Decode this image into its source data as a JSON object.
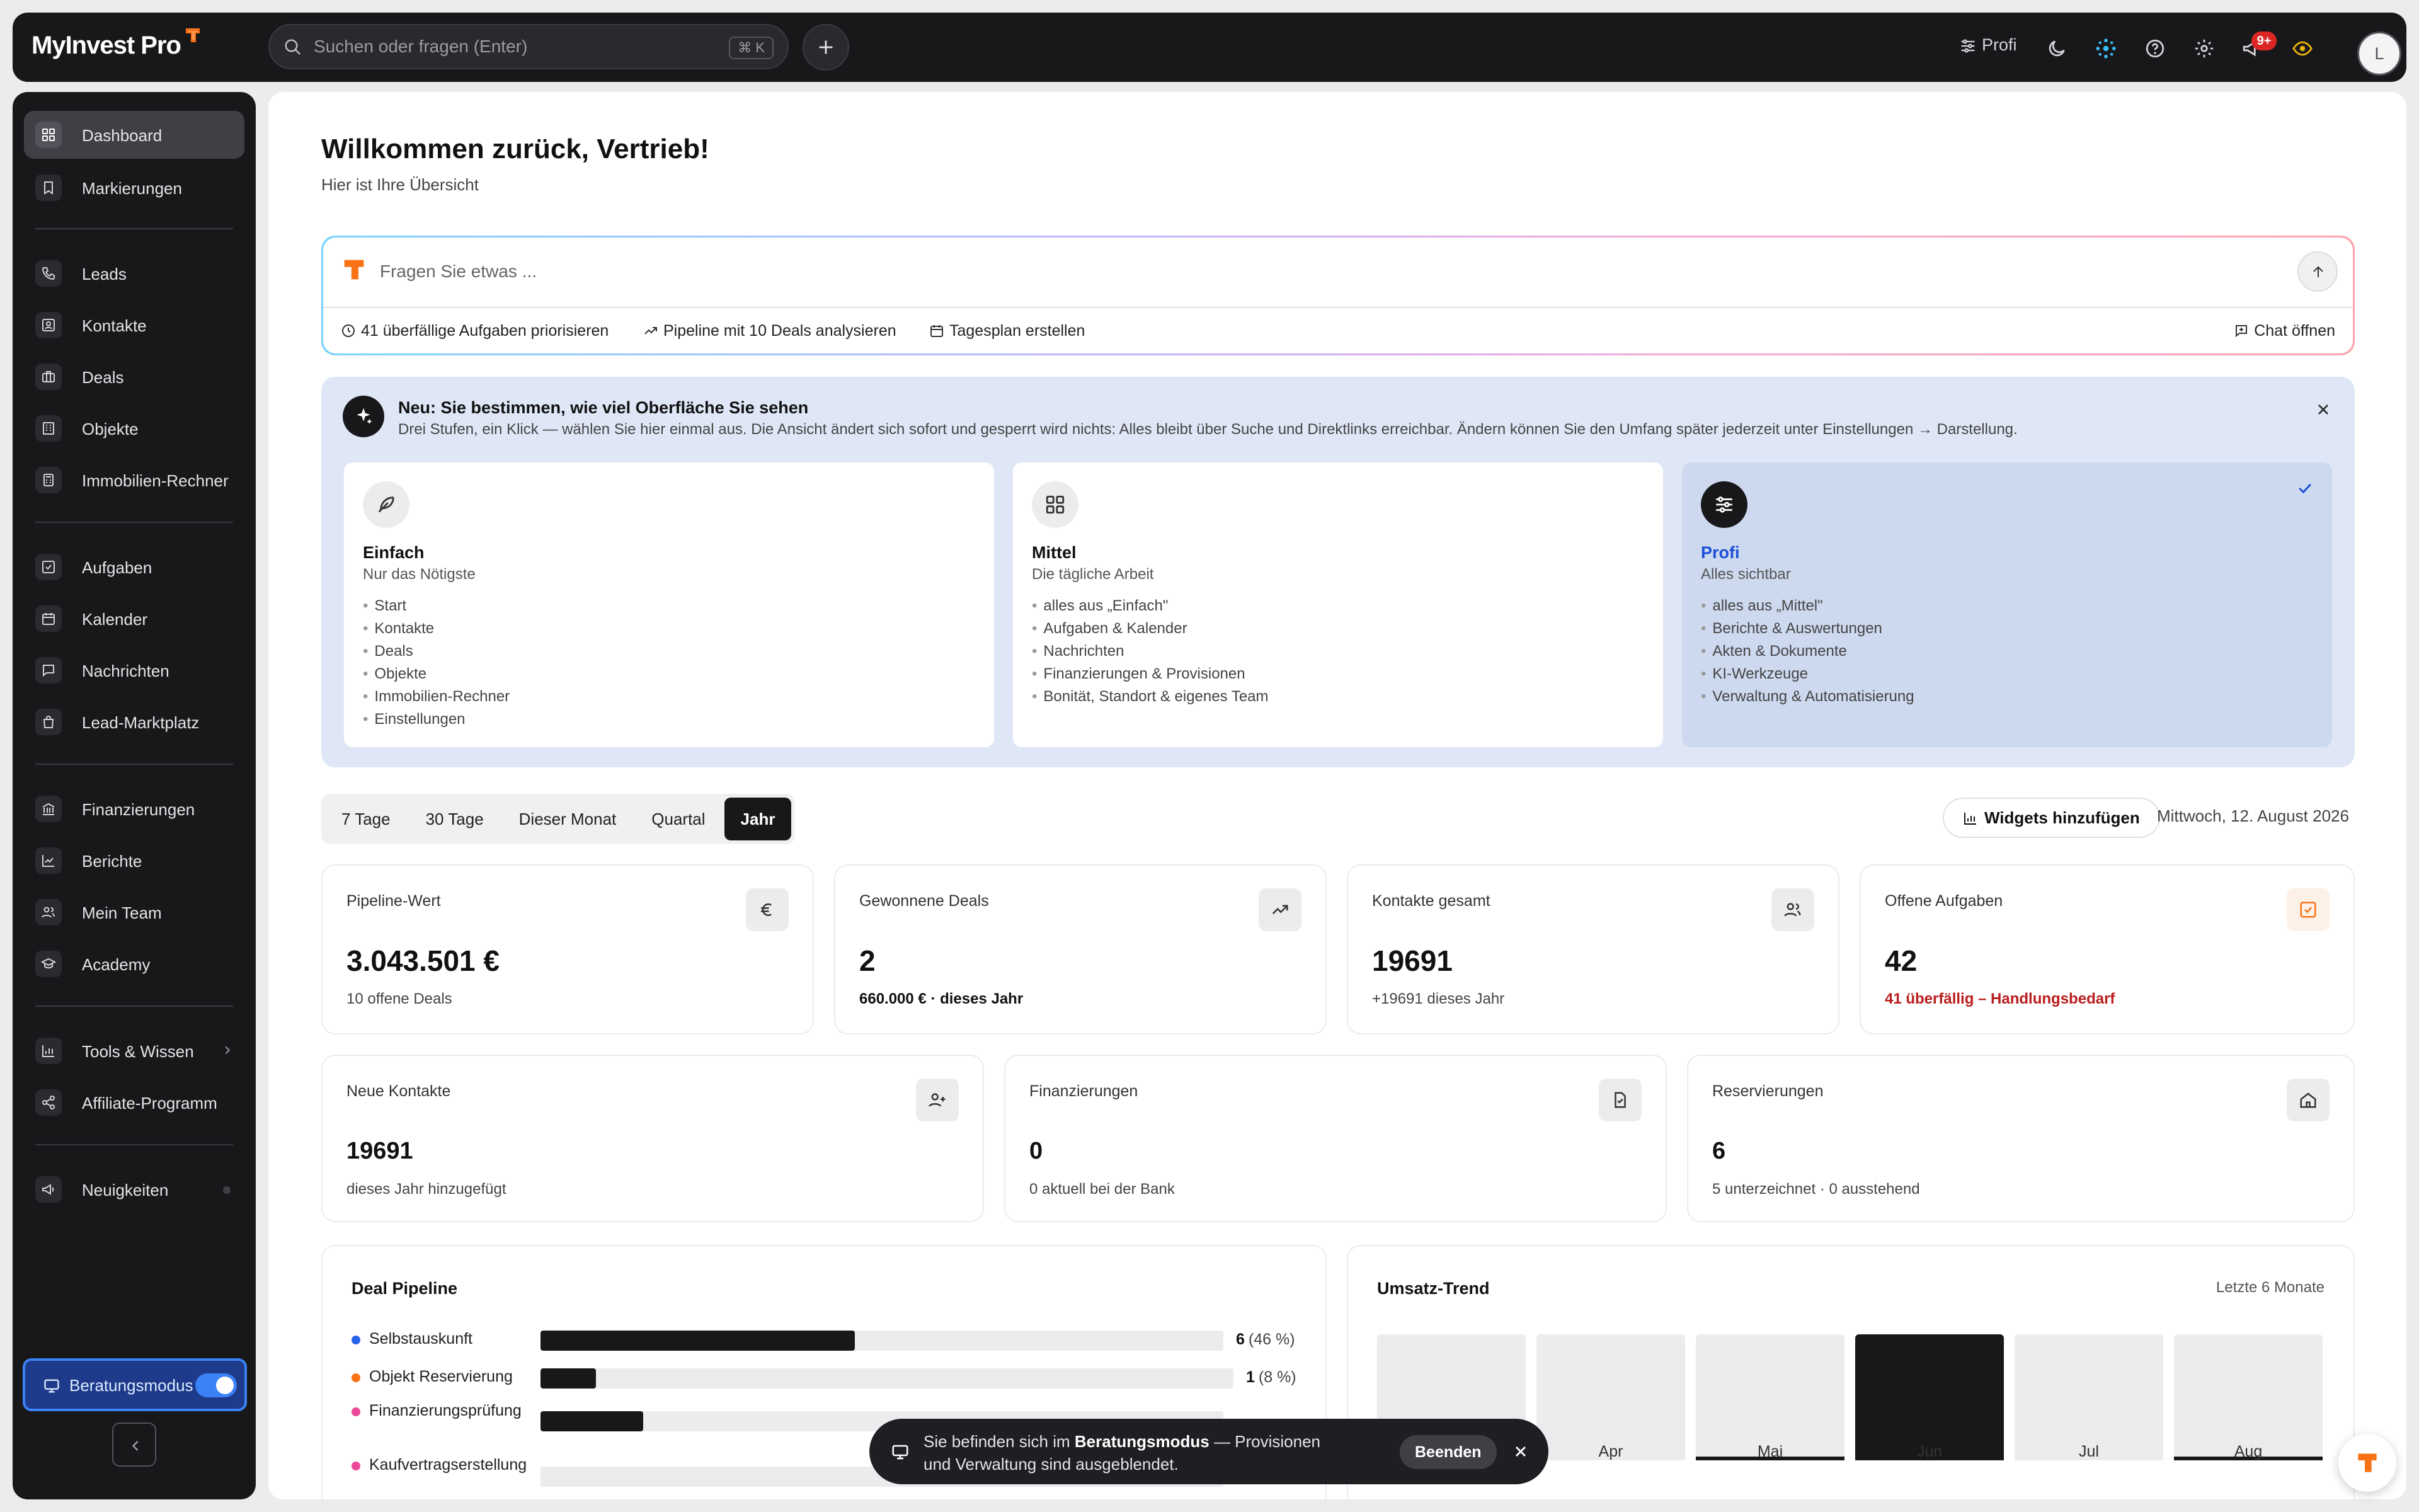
{
  "app": {
    "logo_text": "MyInvest Pro"
  },
  "topbar": {
    "search_placeholder": "Suchen oder fragen (Enter)",
    "search_shortcut": "⌘ K",
    "level_label": "Profi",
    "notification_count": "9+",
    "avatar_initial": "L"
  },
  "sidebar": {
    "items": [
      {
        "label": "Dashboard"
      },
      {
        "label": "Markierungen"
      },
      {
        "label": "Leads"
      },
      {
        "label": "Kontakte"
      },
      {
        "label": "Deals"
      },
      {
        "label": "Objekte"
      },
      {
        "label": "Immobilien-Rechner"
      },
      {
        "label": "Aufgaben"
      },
      {
        "label": "Kalender"
      },
      {
        "label": "Nachrichten"
      },
      {
        "label": "Lead-Marktplatz"
      },
      {
        "label": "Finanzierungen"
      },
      {
        "label": "Berichte"
      },
      {
        "label": "Mein Team"
      },
      {
        "label": "Academy"
      },
      {
        "label": "Tools & Wissen"
      },
      {
        "label": "Affiliate-Programm"
      },
      {
        "label": "Neuigkeiten"
      }
    ],
    "mode_label": "Beratungsmodus"
  },
  "main": {
    "welcome_title": "Willkommen zurück, Vertrieb!",
    "welcome_subtitle": "Hier ist Ihre Übersicht",
    "ai": {
      "placeholder": "Fragen Sie etwas ...",
      "chips": [
        "41 überfällige Aufgaben priorisieren",
        "Pipeline mit 10 Deals analysieren",
        "Tagesplan erstellen"
      ],
      "chat_open": "Chat öffnen"
    },
    "onboarding": {
      "title": "Neu: Sie bestimmen, wie viel Oberfläche Sie sehen",
      "description": "Drei Stufen, ein Klick — wählen Sie hier einmal aus. Die Ansicht ändert sich sofort und gesperrt wird nichts: Alles bleibt über Suche und Direktlinks erreichbar. Ändern können Sie den Umfang später jederzeit unter Einstellungen → Darstellung.",
      "levels": [
        {
          "name": "Einfach",
          "tagline": "Nur das Nötigste",
          "features": [
            "Start",
            "Kontakte",
            "Deals",
            "Objekte",
            "Immobilien-Rechner",
            "Einstellungen"
          ]
        },
        {
          "name": "Mittel",
          "tagline": "Die tägliche Arbeit",
          "features": [
            "alles aus „Einfach\"",
            "Aufgaben & Kalender",
            "Nachrichten",
            "Finanzierungen & Provisionen",
            "Bonität, Standort & eigenes Team"
          ]
        },
        {
          "name": "Profi",
          "tagline": "Alles sichtbar",
          "features": [
            "alles aus „Mittel\"",
            "Berichte & Auswertungen",
            "Akten & Dokumente",
            "KI-Werkzeuge",
            "Verwaltung & Automatisierung"
          ]
        }
      ]
    },
    "periods": [
      "7 Tage",
      "30 Tage",
      "Dieser Monat",
      "Quartal",
      "Jahr"
    ],
    "widgets_button": "Widgets hinzufügen",
    "date": "Mittwoch, 12. August 2026",
    "kpis_row1": [
      {
        "label": "Pipeline-Wert",
        "value": "3.043.501 €",
        "sub": "10 offene Deals",
        "icon": "euro-icon"
      },
      {
        "label": "Gewonnene Deals",
        "value": "2",
        "sub": "660.000 € · dieses Jahr",
        "icon": "trending-up-icon"
      },
      {
        "label": "Kontakte gesamt",
        "value": "19691",
        "sub": "+19691 dieses Jahr",
        "icon": "users-icon"
      },
      {
        "label": "Offene Aufgaben",
        "value": "42",
        "sub": "41 überfällig – Handlungsbedarf",
        "icon": "task-check-icon"
      }
    ],
    "kpis_row2": [
      {
        "label": "Neue Kontakte",
        "value": "19691",
        "sub": "dieses Jahr hinzugefügt",
        "icon": "user-plus-icon"
      },
      {
        "label": "Finanzierungen",
        "value": "0",
        "sub": "0 aktuell bei der Bank",
        "icon": "document-icon"
      },
      {
        "label": "Reservierungen",
        "value": "6",
        "sub": "5 unterzeichnet · 0 ausstehend",
        "icon": "home-icon"
      }
    ],
    "pipeline": {
      "title": "Deal Pipeline",
      "stages": [
        {
          "name": "Selbstauskunft",
          "count": "6",
          "pct": "(46 %)",
          "fill": 0.46,
          "color": "#2563eb"
        },
        {
          "name": "Objekt Reservierung",
          "count": "1",
          "pct": "(8 %)",
          "fill": 0.08,
          "color": "#f97316"
        },
        {
          "name": "Finanzierungsprüfung",
          "count": "",
          "pct": "",
          "fill": 0.15,
          "color": "#ec4899"
        },
        {
          "name": "Kaufvertragserstellung",
          "count": "",
          "pct": "",
          "fill": 0.0,
          "color": "#ec4899"
        }
      ]
    },
    "trend": {
      "title": "Umsatz-Trend",
      "range": "Letzte 6 Monate",
      "months": [
        "",
        "Apr",
        "Mai",
        "Jun",
        "Jul",
        "Aug"
      ],
      "levels": [
        0,
        0,
        0.03,
        1.0,
        0,
        0.03
      ]
    },
    "toast": {
      "text_prefix": "Sie befinden sich im ",
      "text_bold": "Beratungsmodus",
      "text_suffix": " — Provisionen und Verwaltung sind ausgeblendet.",
      "end_label": "Beenden"
    }
  },
  "colors": {
    "accent": "#f97316",
    "brand_dark": "#18181b",
    "highlight_blue": "#1d4ed8",
    "alert": "#b91c1c"
  }
}
